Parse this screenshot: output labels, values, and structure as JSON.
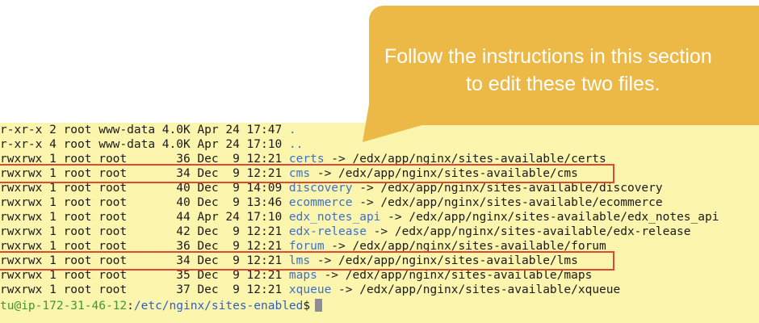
{
  "terminal": {
    "lines": [
      {
        "perm": "r-xr-x 2 root www-data 4.0K Apr 24 17:47 ",
        "name": ".",
        "target": ""
      },
      {
        "perm": "r-xr-x 4 root www-data 4.0K Apr 24 17:10 ",
        "name": "..",
        "target": ""
      },
      {
        "perm": "rwxrwx 1 root root       36 Dec  9 12:21 ",
        "name": "certs",
        "target": " -> /edx/app/nginx/sites-available/certs"
      },
      {
        "perm": "rwxrwx 1 root root       34 Dec  9 12:21 ",
        "name": "cms",
        "target": " -> /edx/app/nginx/sites-available/cms"
      },
      {
        "perm": "rwxrwx 1 root root       40 Dec  9 14:09 ",
        "name": "discovery",
        "target": " -> /edx/app/nginx/sites-available/discovery"
      },
      {
        "perm": "rwxrwx 1 root root       40 Dec  9 13:46 ",
        "name": "ecommerce",
        "target": " -> /edx/app/nginx/sites-available/ecommerce"
      },
      {
        "perm": "rwxrwx 1 root root       44 Apr 24 17:10 ",
        "name": "edx_notes_api",
        "target": " -> /edx/app/nginx/sites-available/edx_notes_api"
      },
      {
        "perm": "rwxrwx 1 root root       42 Dec  9 12:21 ",
        "name": "edx-release",
        "target": " -> /edx/app/nginx/sites-available/edx-release"
      },
      {
        "perm": "rwxrwx 1 root root       36 Dec  9 12:21 ",
        "name": "forum",
        "target": " -> /edx/app/nginx/sites-available/forum"
      },
      {
        "perm": "rwxrwx 1 root root       34 Dec  9 12:21 ",
        "name": "lms",
        "target": " -> /edx/app/nginx/sites-available/lms"
      },
      {
        "perm": "rwxrwx 1 root root       35 Dec  9 12:21 ",
        "name": "maps",
        "target": " -> /edx/app/nginx/sites-available/maps"
      },
      {
        "perm": "rwxrwx 1 root root       37 Dec  9 12:21 ",
        "name": "xqueue",
        "target": " -> /edx/app/nginx/sites-available/xqueue"
      }
    ],
    "prompt": {
      "user": "tu@ip-172-31-46-12",
      "sep": ":",
      "path": "/etc/nginx/sites-enabled",
      "symbol": "$"
    }
  },
  "callout": {
    "line1": "Follow the instructions in this section",
    "line2": "to edit these two files."
  },
  "colors": {
    "terminal_bg": "#fbf5ad",
    "link_blue": "#3b6fd1",
    "prompt_green": "#3d9a2c",
    "highlight_red": "#e0492e",
    "callout_orange": "#ecb846"
  }
}
